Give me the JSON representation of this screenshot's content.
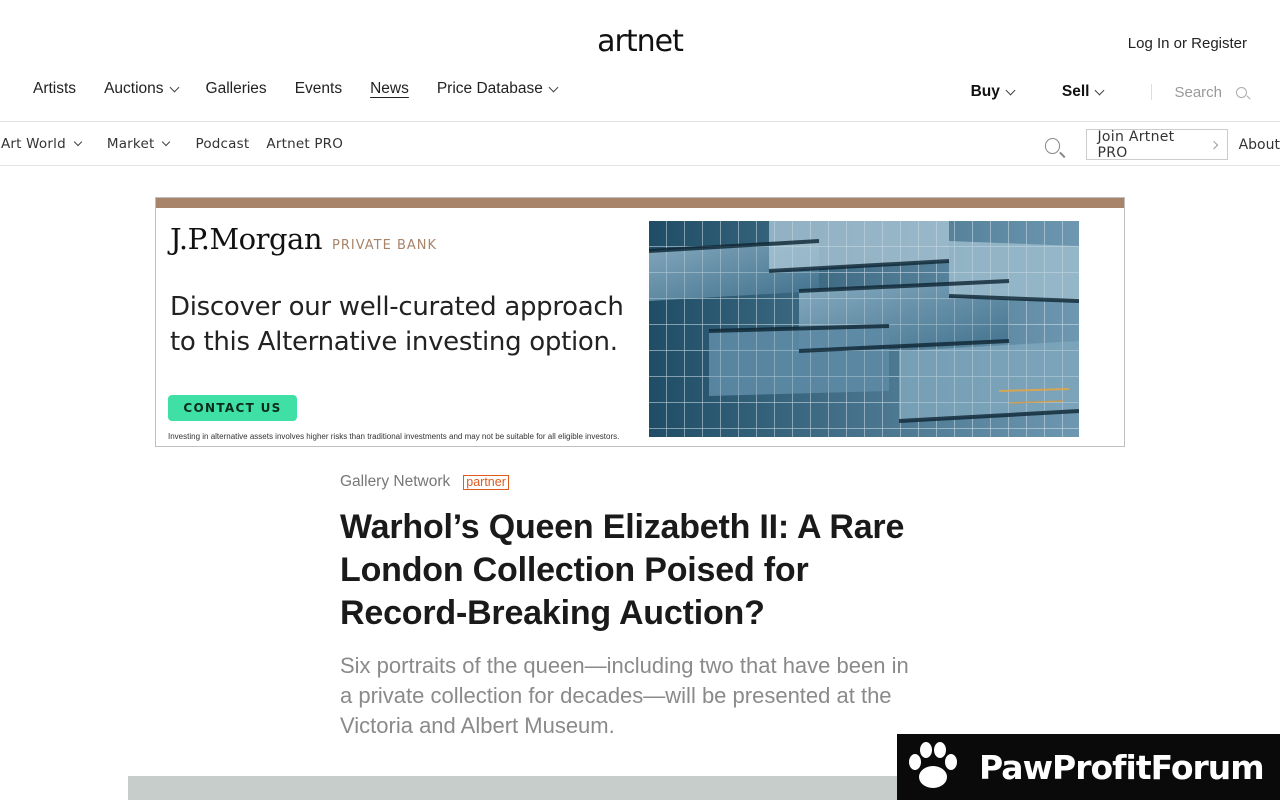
{
  "header": {
    "logo": "artnet",
    "login": "Log In or Register"
  },
  "main_nav": [
    {
      "label": "Artists",
      "dropdown": false,
      "active": false
    },
    {
      "label": "Auctions",
      "dropdown": true,
      "active": false
    },
    {
      "label": "Galleries",
      "dropdown": false,
      "active": false
    },
    {
      "label": "Events",
      "dropdown": false,
      "active": false
    },
    {
      "label": "News",
      "dropdown": false,
      "active": true
    },
    {
      "label": "Price Database",
      "dropdown": true,
      "active": false
    }
  ],
  "right_nav": {
    "buy": "Buy",
    "sell": "Sell",
    "search": "Search"
  },
  "sub_nav": {
    "items": [
      "Art World",
      "Market",
      "Podcast",
      "Artnet PRO"
    ],
    "join_pro": "Join Artnet PRO",
    "about": "About"
  },
  "ad": {
    "brand": "J.P.Morgan",
    "brand_sub": "PRIVATE BANK",
    "headline": "Discover our well-curated approach to this Alternative investing option.",
    "cta": "CONTACT US",
    "disclaimer": "Investing in alternative assets involves higher risks than traditional investments and may not be suitable for all eligible investors.",
    "accent_color": "#a8846a",
    "cta_color": "#3ee0a5"
  },
  "article": {
    "category": "Gallery Network",
    "badge": "partner",
    "title": "Warhol’s Queen Elizabeth II: A Rare London Collection Poised for Record-Breaking Auction?",
    "dek": "Six portraits of the queen—including two that have been in a private collection for decades—will be presented at the Victoria and Albert Museum."
  },
  "watermark": {
    "text": "PawProfitForum"
  }
}
